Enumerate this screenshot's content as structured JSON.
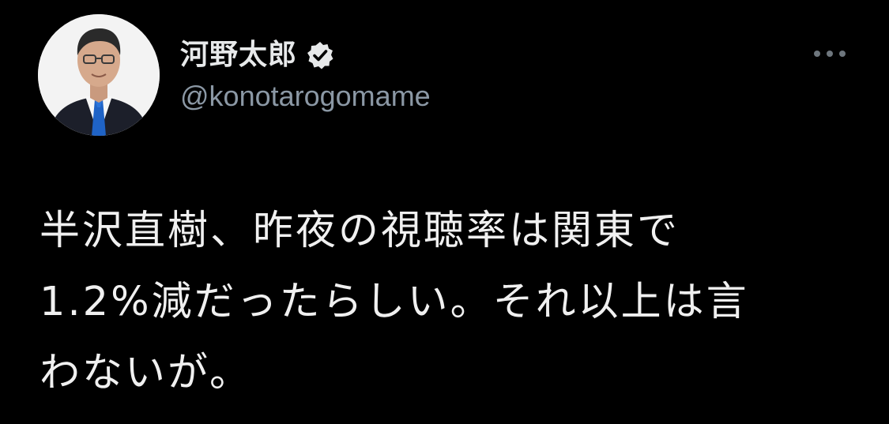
{
  "author": {
    "display_name": "河野太郎",
    "handle": "@konotarogomame",
    "verified": true,
    "verified_icon": "verified-badge-icon",
    "avatar_icon": "profile-photo"
  },
  "menu": {
    "more_icon": "more-options-icon"
  },
  "tweet": {
    "lines": [
      "半沢直樹、昨夜の視聴率は関東で",
      "1.2%減だったらしい。それ以上は言",
      "わないが。"
    ]
  },
  "colors": {
    "background": "#000000",
    "primary_text": "#e7e9ea",
    "secondary_text": "#8b98a5",
    "badge": "#e7e9ea"
  }
}
